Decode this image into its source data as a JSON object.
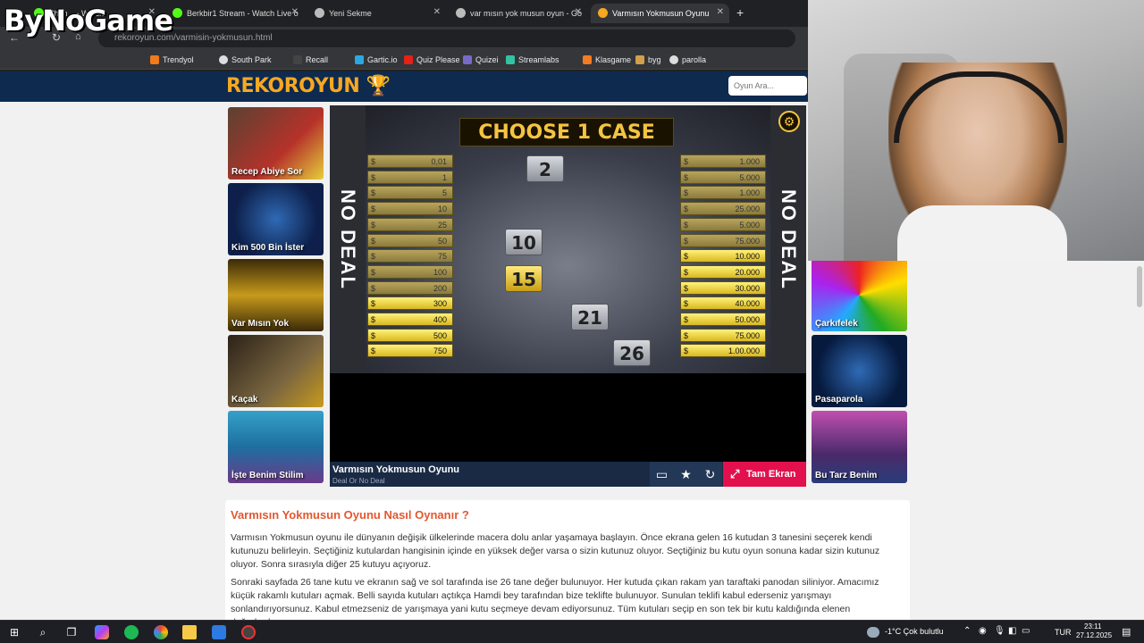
{
  "browser": {
    "tabs": [
      {
        "label": "Chan... - Watch",
        "color": "#53fc18"
      },
      {
        "label": "Berkbir1 Stream - Watch Live o",
        "color": "#53fc18"
      },
      {
        "label": "Yeni Sekme",
        "color": "#bbbbbb"
      },
      {
        "label": "var mısın yok musun oyun - Go",
        "color": "#bbbbbb"
      },
      {
        "label": "Varmısın Yokmusun Oyunu",
        "color": "#f6a821"
      }
    ],
    "url": "rekoroyun.com/varmisin-yokmusun.html",
    "bookmarks": [
      "Trendyol",
      "South Park",
      "Recall",
      "Gartic.io",
      "Quiz Please",
      "Quizei",
      "Streamlabs",
      "Klasgame",
      "byg",
      "parolla"
    ]
  },
  "site": {
    "logo": "REKOROYUN",
    "search_placeholder": "Oyun Ara..."
  },
  "left_tiles": [
    "Recep Abiye Sor",
    "Kim 500 Bin İster",
    "Var Mısın Yok",
    "Kaçak",
    "İşte Benim Stilim"
  ],
  "right_tiles": [
    "Çarkıfelek",
    "Pasaparola",
    "Bu Tarz Benim"
  ],
  "game": {
    "banner": "CHOOSE 1 CASE",
    "side_text": "NO DEAL",
    "left_values": [
      "0,01",
      "1",
      "5",
      "10",
      "25",
      "50",
      "75",
      "100",
      "200",
      "300",
      "400",
      "500",
      "750"
    ],
    "right_values": [
      "1.000",
      "5.000",
      "1.000",
      "25.000",
      "5.000",
      "75.000",
      "10.000",
      "20.000",
      "30.000",
      "40.000",
      "50.000",
      "75.000",
      "1.00.000"
    ],
    "currency": "$",
    "cases": [
      "2",
      "10",
      "15",
      "21",
      "26"
    ],
    "title": "Varmısın Yokmusun Oyunu",
    "subtitle": "Deal Or No Deal",
    "fullscreen_label": "Tam Ekran"
  },
  "article": {
    "heading": "Varmısın Yokmusun Oyunu Nasıl Oynanır ?",
    "p1": "Varmısın Yokmusun oyunu ile dünyanın değişik ülkelerinde macera dolu anlar yaşamaya başlayın. Önce ekrana gelen 16 kutudan 3 tanesini seçerek kendi kutunuzu belirleyin. Seçtiğiniz kutulardan hangisinin içinde en yüksek değer varsa o sizin kutunuz oluyor. Seçtiğiniz bu kutu oyun sonuna kadar sizin kutunuz oluyor. Sonra sırasıyla diğer 25 kutuyu açıyoruz.",
    "p2": "Sonraki sayfada 26 tane kutu ve ekranın sağ ve sol tarafında ise 26 tane değer bulunuyor. Her kutuda çıkan rakam yan taraftaki panodan siliniyor. Amacımız küçük rakamlı kutuları açmak. Belli sayıda kutuları açtıkça Hamdi bey tarafından bize teklifte bulunuyor. Sunulan teklifi kabul ederseniz yarışmayı sonlandırıyorsunuz. Kabul etmezseniz de yarışmaya yani kutu seçmeye devam ediyorsunuz. Tüm kutuları seçip en son tek bir kutu kaldığında elenen değerlerde"
  },
  "overlay": {
    "watermark": "ByNoGame"
  },
  "taskbar": {
    "weather": "-1°C  Çok bulutlu",
    "lang": "TUR",
    "time": "23:11",
    "date": "27.12.2025"
  }
}
